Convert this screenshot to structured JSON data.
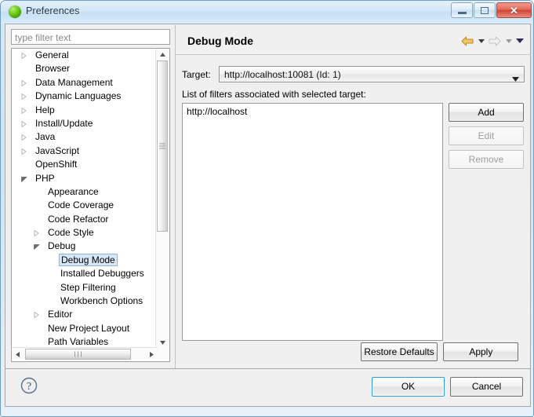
{
  "window": {
    "title": "Preferences",
    "icon": "green-sphere-icon",
    "controls": {
      "minimize": "minimize-button",
      "maximize": "maximize-button",
      "close": "close-button",
      "close_glyph": "✕"
    }
  },
  "sidebar": {
    "filter": {
      "placeholder": "type filter text",
      "value": ""
    },
    "tree": [
      {
        "label": "General",
        "indent": 0,
        "twisty": "collapsed",
        "selected": false
      },
      {
        "label": "Browser",
        "indent": 0,
        "twisty": "none",
        "selected": false
      },
      {
        "label": "Data Management",
        "indent": 0,
        "twisty": "collapsed",
        "selected": false
      },
      {
        "label": "Dynamic Languages",
        "indent": 0,
        "twisty": "collapsed",
        "selected": false
      },
      {
        "label": "Help",
        "indent": 0,
        "twisty": "collapsed",
        "selected": false
      },
      {
        "label": "Install/Update",
        "indent": 0,
        "twisty": "collapsed",
        "selected": false
      },
      {
        "label": "Java",
        "indent": 0,
        "twisty": "collapsed",
        "selected": false
      },
      {
        "label": "JavaScript",
        "indent": 0,
        "twisty": "collapsed",
        "selected": false
      },
      {
        "label": "OpenShift",
        "indent": 0,
        "twisty": "none",
        "selected": false
      },
      {
        "label": "PHP",
        "indent": 0,
        "twisty": "expanded",
        "selected": false
      },
      {
        "label": "Appearance",
        "indent": 1,
        "twisty": "none",
        "selected": false
      },
      {
        "label": "Code Coverage",
        "indent": 1,
        "twisty": "none",
        "selected": false
      },
      {
        "label": "Code Refactor",
        "indent": 1,
        "twisty": "none",
        "selected": false
      },
      {
        "label": "Code Style",
        "indent": 1,
        "twisty": "collapsed",
        "selected": false
      },
      {
        "label": "Debug",
        "indent": 1,
        "twisty": "expanded",
        "selected": false
      },
      {
        "label": "Debug Mode",
        "indent": 2,
        "twisty": "none",
        "selected": true
      },
      {
        "label": "Installed Debuggers",
        "indent": 2,
        "twisty": "none",
        "selected": false
      },
      {
        "label": "Step Filtering",
        "indent": 2,
        "twisty": "none",
        "selected": false
      },
      {
        "label": "Workbench Options",
        "indent": 2,
        "twisty": "none",
        "selected": false
      },
      {
        "label": "Editor",
        "indent": 1,
        "twisty": "collapsed",
        "selected": false
      },
      {
        "label": "New Project Layout",
        "indent": 1,
        "twisty": "none",
        "selected": false
      },
      {
        "label": "Path Variables",
        "indent": 1,
        "twisty": "none",
        "selected": false
      }
    ]
  },
  "pane": {
    "title": "Debug Mode",
    "nav": {
      "back": "back-arrow-icon",
      "back_enabled": true,
      "back_menu": "back-dropdown-icon",
      "forward": "forward-arrow-icon",
      "forward_enabled": false,
      "forward_menu": "forward-dropdown-icon",
      "view_menu": "view-menu-icon"
    },
    "target": {
      "label": "Target:",
      "value": "http://localhost:10081 (Id: 1)",
      "caret": "chevron-down-icon"
    },
    "filters": {
      "label": "List of filters associated with selected target:",
      "items": [
        "http://localhost"
      ],
      "buttons": [
        {
          "label": "Add",
          "enabled": true
        },
        {
          "label": "Edit",
          "enabled": false
        },
        {
          "label": "Remove",
          "enabled": false
        }
      ]
    },
    "bottom_buttons": {
      "restore_defaults": "Restore Defaults",
      "apply": "Apply"
    }
  },
  "footer": {
    "help_icon": "help-question-icon",
    "ok": "OK",
    "cancel": "Cancel"
  },
  "colors": {
    "title_bar_blue": "#cfe3f4",
    "selection_blue": "#d6e7f7",
    "selection_border": "#8fb4d9",
    "pane_bg": "#f0f0f0",
    "close_red": "#cf4434",
    "back_arrow_gold": "#e0a33c",
    "default_button_focus": "#2a9fd8"
  }
}
